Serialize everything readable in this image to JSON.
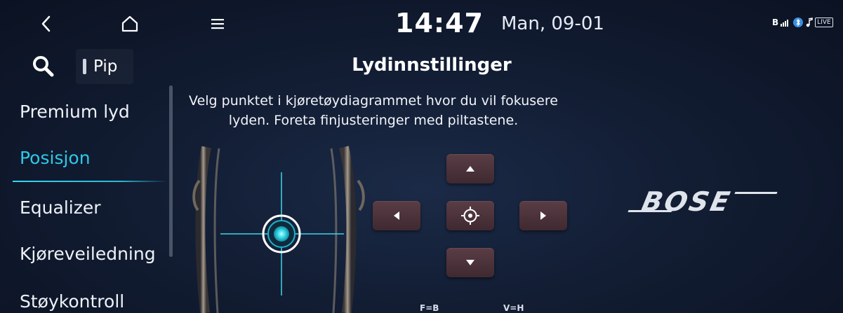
{
  "status_bar": {
    "time": "14:47",
    "date": "Man, 09-01",
    "bt_label": "B",
    "live_label": "LIVE"
  },
  "toolbar": {
    "pip_label": "Pip"
  },
  "page": {
    "title": "Lydinnstillinger",
    "instruction": "Velg punktet i kjøretøydiagrammet hvor du vil fokusere lyden. Foreta finjusteringer med piltastene."
  },
  "menu": {
    "items": [
      {
        "label": "Premium lyd",
        "active": false
      },
      {
        "label": "Posisjon",
        "active": true
      },
      {
        "label": "Equalizer",
        "active": false
      },
      {
        "label": "Kjøreveiledning",
        "active": false
      },
      {
        "label": "Støykontroll",
        "active": false
      }
    ]
  },
  "fader": {
    "front_rear_label": "F=B",
    "left_right_label": "V=H"
  },
  "brand": {
    "logo_text": "BOSE"
  },
  "colors": {
    "accent": "#2ec8e8",
    "button": "#4c333a",
    "background": "#121d33"
  },
  "icons": {
    "back": "chevron-left-icon",
    "home": "home-icon",
    "menu": "hamburger-icon",
    "search": "search-icon",
    "up": "arrow-up-icon",
    "down": "arrow-down-icon",
    "left": "arrow-left-icon",
    "right": "arrow-right-icon",
    "center": "crosshair-icon"
  }
}
